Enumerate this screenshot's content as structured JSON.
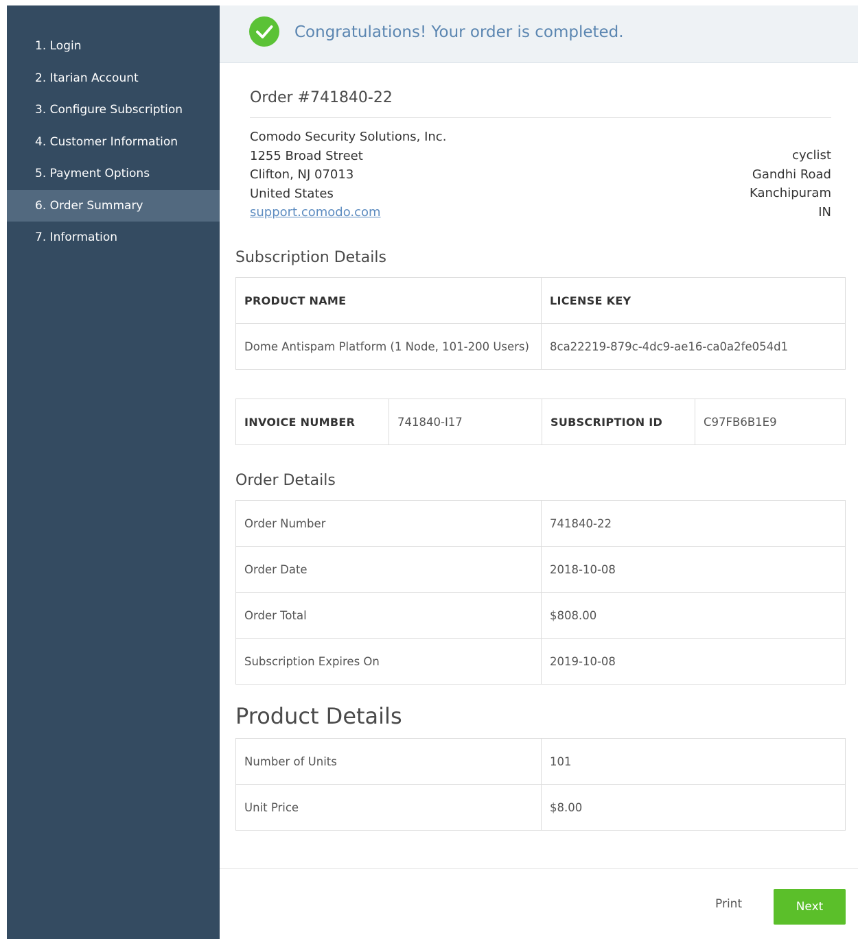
{
  "sidebar": {
    "items": [
      {
        "label": "1. Login"
      },
      {
        "label": "2. Itarian Account"
      },
      {
        "label": "3. Configure Subscription"
      },
      {
        "label": "4. Customer Information"
      },
      {
        "label": "5. Payment Options"
      },
      {
        "label": "6. Order Summary",
        "active": true
      },
      {
        "label": "7. Information"
      }
    ]
  },
  "banner": {
    "icon": "check-circle-icon",
    "message": "Congratulations! Your order is completed."
  },
  "order": {
    "title": "Order #741840-22"
  },
  "seller": {
    "company": "Comodo Security Solutions, Inc.",
    "street": "1255 Broad Street",
    "city": "Clifton, NJ 07013",
    "country": "United States",
    "link": "support.comodo.com"
  },
  "customer": {
    "name": "cyclist",
    "street": "Gandhi Road",
    "city": "Kanchipuram",
    "country": "IN"
  },
  "subscription_details": {
    "title": "Subscription Details",
    "headers": {
      "product_name": "PRODUCT NAME",
      "license_key": "LICENSE KEY"
    },
    "product_name": "Dome Antispam Platform (1 Node, 101-200 Users)",
    "license_key": "8ca22219-879c-4dc9-ae16-ca0a2fe054d1"
  },
  "invoice": {
    "invoice_number_label": "INVOICE NUMBER",
    "invoice_number": "741840-I17",
    "subscription_id_label": "SUBSCRIPTION ID",
    "subscription_id": "C97FB6B1E9"
  },
  "order_details": {
    "title": "Order Details",
    "rows": [
      {
        "label": "Order Number",
        "value": "741840-22"
      },
      {
        "label": "Order Date",
        "value": "2018-10-08"
      },
      {
        "label": "Order Total",
        "value": "$808.00"
      },
      {
        "label": "Subscription Expires On",
        "value": "2019-10-08"
      }
    ]
  },
  "product_details": {
    "title": "Product Details",
    "rows": [
      {
        "label": "Number of Units",
        "value": "101"
      },
      {
        "label": "Unit Price",
        "value": "$8.00"
      }
    ]
  },
  "actions": {
    "print_label": "Print",
    "next_label": "Next"
  },
  "colors": {
    "sidebar_bg": "#344b61",
    "sidebar_active": "#52697f",
    "success_green": "#5bc236",
    "banner_text": "#5b86b1",
    "next_button": "#5bbf2a"
  }
}
